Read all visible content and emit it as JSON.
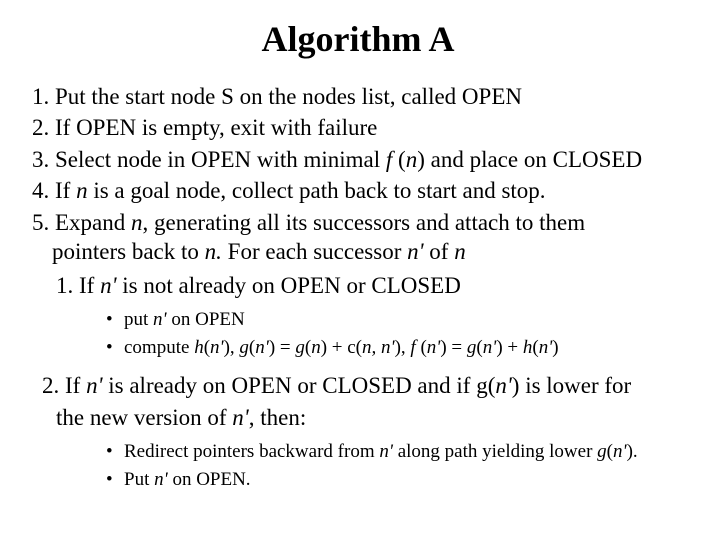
{
  "title": "Algorithm A",
  "steps": {
    "s1": "1. Put the start node S on the nodes list, called OPEN",
    "s2": "2. If OPEN is empty, exit with failure",
    "s3_a": "3. Select node in OPEN with minimal ",
    "s3_f": "f ",
    "s3_paren_open": "(",
    "s3_n": "n",
    "s3_b": ") and place on CLOSED",
    "s4_a": "4. If ",
    "s4_n": "n",
    "s4_b": " is a goal node, collect path back to start and stop.",
    "s5_a": "5. Expand ",
    "s5_n": "n",
    "s5_b": ", generating all its successors and attach to them",
    "s5c_a": "pointers back to ",
    "s5c_n": "n.",
    "s5c_b": "  For each successor ",
    "s5c_np": "n'",
    "s5c_c": " of ",
    "s5c_n2": "n"
  },
  "sub": {
    "s51_a": "1. If ",
    "s51_np": "n'",
    "s51_b": " is not already on OPEN or CLOSED",
    "b1_a": "put ",
    "b1_np": "n'",
    "b1_b": " on OPEN",
    "b2_a": "compute ",
    "b2_h": "h",
    "b2_paren1": "(",
    "b2_np1": "n'",
    "b2_sep1": "),  ",
    "b2_g": "g",
    "b2_paren2": "(",
    "b2_np2": "n'",
    "b2_eq1": ") = ",
    "b2_g2": "g",
    "b2_paren3": "(",
    "b2_n": "n",
    "b2_plus1": ") + c(",
    "b2_nn": "n, n'",
    "b2_sep2": "),  ",
    "b2_f": "f ",
    "b2_paren4": "(",
    "b2_np3": "n'",
    "b2_eq2": ") = ",
    "b2_g3": "g",
    "b2_paren5": "(",
    "b2_np4": "n'",
    "b2_plus2": ") + ",
    "b2_h2": "h",
    "b2_paren6": "(",
    "b2_np5": "n'",
    "b2_close": ")",
    "s52_a": "2. If ",
    "s52_np": "n'",
    "s52_b": " is already on OPEN or CLOSED and if g(",
    "s52_np2": "n'",
    "s52_c": ") is lower for",
    "s52d_a": "the new version of ",
    "s52d_np": "n'",
    "s52d_b": ", then:",
    "b3_a": "Redirect pointers backward from ",
    "b3_np": "n'",
    "b3_b": " along path yielding lower ",
    "b3_g": "g",
    "b3_paren": "(",
    "b3_np2": "n'",
    "b3_close": ").",
    "b4_a": "Put ",
    "b4_np": "n'",
    "b4_b": " on OPEN."
  },
  "glyph": {
    "bullet": "•"
  }
}
